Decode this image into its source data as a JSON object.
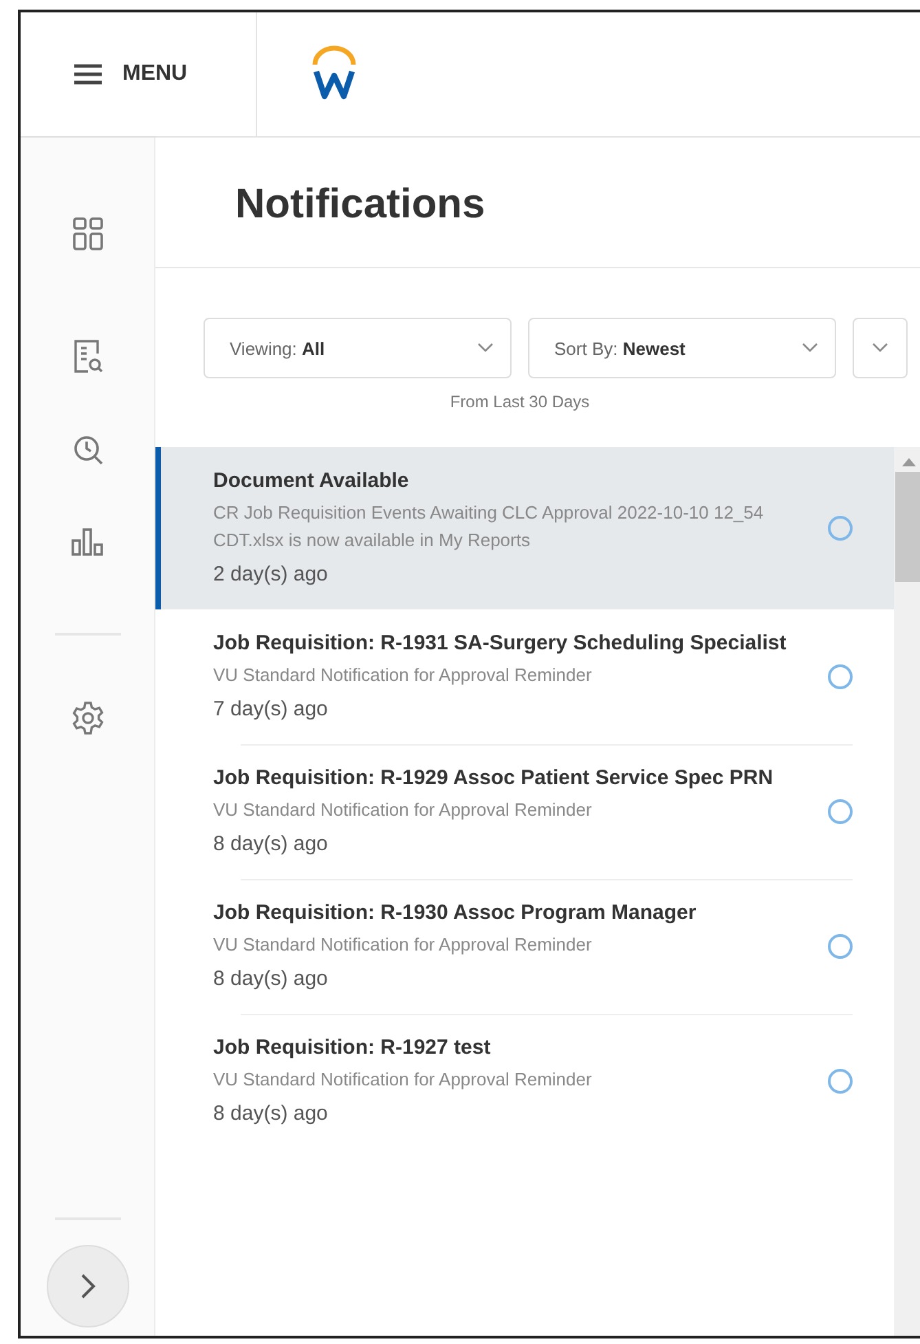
{
  "header": {
    "menu_label": "MENU"
  },
  "page_title": "Notifications",
  "filters": [
    {
      "label": "Viewing:",
      "value": "All"
    },
    {
      "label": "Sort By:",
      "value": "Newest"
    }
  ],
  "date_range": "From Last 30 Days",
  "notifications": [
    {
      "title": "Document Available",
      "description": "CR Job Requisition Events Awaiting CLC Approval 2022-10-10 12_54 CDT.xlsx is now available in My Reports",
      "time": "2 day(s) ago",
      "selected": true
    },
    {
      "title": "Job Requisition: R-1931 SA-Surgery Scheduling Specialist",
      "description": "VU Standard Notification for Approval Reminder",
      "time": "7 day(s) ago",
      "selected": false
    },
    {
      "title": "Job Requisition: R-1929 Assoc Patient Service Spec PRN",
      "description": "VU Standard Notification for Approval Reminder",
      "time": "8 day(s) ago",
      "selected": false
    },
    {
      "title": "Job Requisition: R-1930 Assoc Program Manager",
      "description": "VU Standard Notification for Approval Reminder",
      "time": "8 day(s) ago",
      "selected": false
    },
    {
      "title": "Job Requisition: R-1927 test",
      "description": "VU Standard Notification for Approval Reminder",
      "time": "8 day(s) ago",
      "selected": false
    }
  ]
}
